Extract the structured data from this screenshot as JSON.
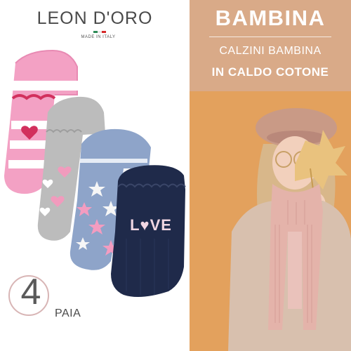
{
  "brand": {
    "name": "LEON D'ORO",
    "tagline": "MADE IN ITALY",
    "flag_colors": [
      "#2e8b57",
      "#ffffff",
      "#d62828"
    ]
  },
  "banner": {
    "title": "BAMBINA",
    "subtitle_line1": "CALZINI BAMBINA",
    "subtitle_line2": "IN CALDO COTONE"
  },
  "badge": {
    "count": "4",
    "unit": "PAIA"
  },
  "socks": [
    {
      "color": "#f3a1c4",
      "pattern": "stripes-hearts"
    },
    {
      "color": "#bcbcbc",
      "pattern": "pink-hearts"
    },
    {
      "color": "#8ea4c9",
      "pattern": "pink-white-stars"
    },
    {
      "color": "#1f2a4a",
      "pattern": "love-text",
      "text": "L♥VE"
    }
  ],
  "colors": {
    "banner_bg": "#d9aa88",
    "photo_bg": "#e3a15d"
  }
}
